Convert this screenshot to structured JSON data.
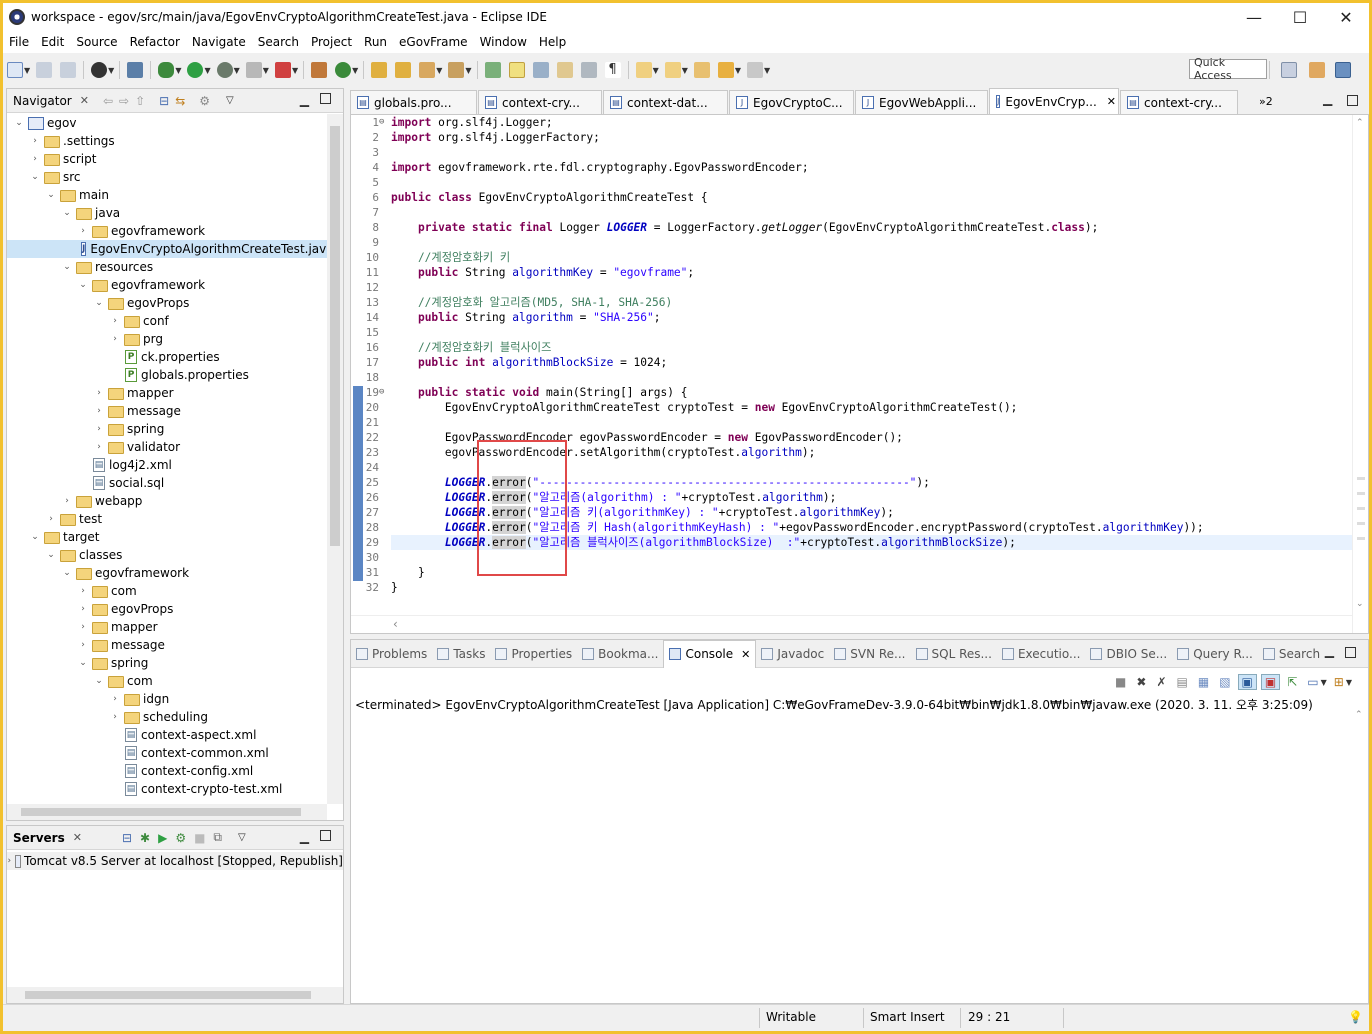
{
  "window": {
    "title": "workspace - egov/src/main/java/EgovEnvCryptoAlgorithmCreateTest.java - Eclipse IDE",
    "minimize": "—",
    "maximize": "☐",
    "close": "✕"
  },
  "menu": [
    "File",
    "Edit",
    "Source",
    "Refactor",
    "Navigate",
    "Search",
    "Project",
    "Run",
    "eGovFrame",
    "Window",
    "Help"
  ],
  "toolbar": {
    "quick_access": "Quick Access"
  },
  "navigator": {
    "title": "Navigator",
    "items": [
      {
        "label": "egov",
        "depth": 0,
        "icon": "project",
        "open": true
      },
      {
        "label": ".settings",
        "depth": 1,
        "icon": "folder",
        "open": false
      },
      {
        "label": "script",
        "depth": 1,
        "icon": "folder",
        "open": false
      },
      {
        "label": "src",
        "depth": 1,
        "icon": "folder",
        "open": true
      },
      {
        "label": "main",
        "depth": 2,
        "icon": "folder",
        "open": true
      },
      {
        "label": "java",
        "depth": 3,
        "icon": "folder",
        "open": true
      },
      {
        "label": "egovframework",
        "depth": 4,
        "icon": "folder",
        "open": false
      },
      {
        "label": "EgovEnvCryptoAlgorithmCreateTest.java",
        "depth": 4,
        "icon": "java",
        "selected": true
      },
      {
        "label": "resources",
        "depth": 3,
        "icon": "folder",
        "open": true
      },
      {
        "label": "egovframework",
        "depth": 4,
        "icon": "folder",
        "open": true
      },
      {
        "label": "egovProps",
        "depth": 5,
        "icon": "folder",
        "open": true
      },
      {
        "label": "conf",
        "depth": 6,
        "icon": "folder",
        "open": false
      },
      {
        "label": "prg",
        "depth": 6,
        "icon": "folder",
        "open": false
      },
      {
        "label": "ck.properties",
        "depth": 6,
        "icon": "props"
      },
      {
        "label": "globals.properties",
        "depth": 6,
        "icon": "props"
      },
      {
        "label": "mapper",
        "depth": 5,
        "icon": "folder",
        "open": false
      },
      {
        "label": "message",
        "depth": 5,
        "icon": "folder",
        "open": false
      },
      {
        "label": "spring",
        "depth": 5,
        "icon": "folder",
        "open": false
      },
      {
        "label": "validator",
        "depth": 5,
        "icon": "folder",
        "open": false
      },
      {
        "label": "log4j2.xml",
        "depth": 4,
        "icon": "xml"
      },
      {
        "label": "social.sql",
        "depth": 4,
        "icon": "xml"
      },
      {
        "label": "webapp",
        "depth": 3,
        "icon": "folder",
        "open": false
      },
      {
        "label": "test",
        "depth": 2,
        "icon": "folder",
        "open": false
      },
      {
        "label": "target",
        "depth": 1,
        "icon": "folder",
        "open": true
      },
      {
        "label": "classes",
        "depth": 2,
        "icon": "folder",
        "open": true
      },
      {
        "label": "egovframework",
        "depth": 3,
        "icon": "folder",
        "open": true
      },
      {
        "label": "com",
        "depth": 4,
        "icon": "folder",
        "open": false
      },
      {
        "label": "egovProps",
        "depth": 4,
        "icon": "folder",
        "open": false
      },
      {
        "label": "mapper",
        "depth": 4,
        "icon": "folder",
        "open": false
      },
      {
        "label": "message",
        "depth": 4,
        "icon": "folder",
        "open": false
      },
      {
        "label": "spring",
        "depth": 4,
        "icon": "folder",
        "open": true
      },
      {
        "label": "com",
        "depth": 5,
        "icon": "folder",
        "open": true
      },
      {
        "label": "idgn",
        "depth": 6,
        "icon": "folder",
        "open": false
      },
      {
        "label": "scheduling",
        "depth": 6,
        "icon": "folder",
        "open": false
      },
      {
        "label": "context-aspect.xml",
        "depth": 6,
        "icon": "xml"
      },
      {
        "label": "context-common.xml",
        "depth": 6,
        "icon": "xml"
      },
      {
        "label": "context-config.xml",
        "depth": 6,
        "icon": "xml"
      },
      {
        "label": "context-crypto-test.xml",
        "depth": 6,
        "icon": "xml"
      }
    ]
  },
  "servers": {
    "title": "Servers",
    "items": [
      "Tomcat v8.5 Server at localhost  [Stopped, Republish]"
    ]
  },
  "editor_tabs": [
    {
      "label": "globals.pro...",
      "active": false
    },
    {
      "label": "context-cry...",
      "active": false
    },
    {
      "label": "context-dat...",
      "active": false
    },
    {
      "label": "EgovCryptoC...",
      "active": false
    },
    {
      "label": "EgovWebAppli...",
      "active": false
    },
    {
      "label": "EgovEnvCryp...",
      "active": true
    },
    {
      "label": "context-cry...",
      "active": false
    }
  ],
  "editor_overflow": "»2",
  "code_lines": [
    {
      "n": "1",
      "text": "import org.slf4j.Logger;"
    },
    {
      "n": "2",
      "text": "import org.slf4j.LoggerFactory;"
    },
    {
      "n": "3",
      "text": ""
    },
    {
      "n": "4",
      "text": "import egovframework.rte.fdl.cryptography.EgovPasswordEncoder;"
    },
    {
      "n": "5",
      "text": ""
    },
    {
      "n": "6",
      "text": "public class EgovEnvCryptoAlgorithmCreateTest {"
    },
    {
      "n": "7",
      "text": ""
    },
    {
      "n": "8",
      "text": "    private static final Logger LOGGER = LoggerFactory.getLogger(EgovEnvCryptoAlgorithmCreateTest.class);"
    },
    {
      "n": "9",
      "text": ""
    },
    {
      "n": "10",
      "text": "    //계정암호화키 키"
    },
    {
      "n": "11",
      "text": "    public String algorithmKey = \"egovframe\";"
    },
    {
      "n": "12",
      "text": ""
    },
    {
      "n": "13",
      "text": "    //계정암호화 알고리즘(MD5, SHA-1, SHA-256)"
    },
    {
      "n": "14",
      "text": "    public String algorithm = \"SHA-256\";"
    },
    {
      "n": "15",
      "text": ""
    },
    {
      "n": "16",
      "text": "    //계정암호화키 블럭사이즈"
    },
    {
      "n": "17",
      "text": "    public int algorithmBlockSize = 1024;"
    },
    {
      "n": "18",
      "text": ""
    },
    {
      "n": "19",
      "text": "    public static void main(String[] args) {"
    },
    {
      "n": "20",
      "text": "        EgovEnvCryptoAlgorithmCreateTest cryptoTest = new EgovEnvCryptoAlgorithmCreateTest();"
    },
    {
      "n": "21",
      "text": ""
    },
    {
      "n": "22",
      "text": "        EgovPasswordEncoder egovPasswordEncoder = new EgovPasswordEncoder();"
    },
    {
      "n": "23",
      "text": "        egovPasswordEncoder.setAlgorithm(cryptoTest.algorithm);"
    },
    {
      "n": "24",
      "text": ""
    },
    {
      "n": "25",
      "text": "        LOGGER.error(\"-------------------------------------------------------\");"
    },
    {
      "n": "26",
      "text": "        LOGGER.error(\"알고리즘(algorithm) : \"+cryptoTest.algorithm);"
    },
    {
      "n": "27",
      "text": "        LOGGER.error(\"알고리즘 키(algorithmKey) : \"+cryptoTest.algorithmKey);"
    },
    {
      "n": "28",
      "text": "        LOGGER.error(\"알고리즘 키 Hash(algorithmKeyHash) : \"+egovPasswordEncoder.encryptPassword(cryptoTest.algorithmKey));"
    },
    {
      "n": "29",
      "text": "        LOGGER.error(\"알고리즘 블럭사이즈(algorithmBlockSize)  :\"+cryptoTest.algorithmBlockSize);"
    },
    {
      "n": "30",
      "text": ""
    },
    {
      "n": "31",
      "text": "    }"
    },
    {
      "n": "32",
      "text": "}"
    }
  ],
  "bottom_tabs": [
    {
      "label": "Problems",
      "active": false
    },
    {
      "label": "Tasks",
      "active": false
    },
    {
      "label": "Properties",
      "active": false
    },
    {
      "label": "Bookma...",
      "active": false
    },
    {
      "label": "Console",
      "active": true
    },
    {
      "label": "Javadoc",
      "active": false
    },
    {
      "label": "SVN Re...",
      "active": false
    },
    {
      "label": "SQL Res...",
      "active": false
    },
    {
      "label": "Executio...",
      "active": false
    },
    {
      "label": "DBIO Se...",
      "active": false
    },
    {
      "label": "Query R...",
      "active": false
    },
    {
      "label": "Search",
      "active": false
    }
  ],
  "console_text": "<terminated> EgovEnvCryptoAlgorithmCreateTest [Java Application] C:₩eGovFrameDev-3.9.0-64bit₩bin₩jdk1.8.0₩bin₩javaw.exe (2020. 3. 11. 오후 3:25:09)",
  "status": {
    "writable": "Writable",
    "insert_mode": "Smart Insert",
    "position": "29 : 21"
  }
}
